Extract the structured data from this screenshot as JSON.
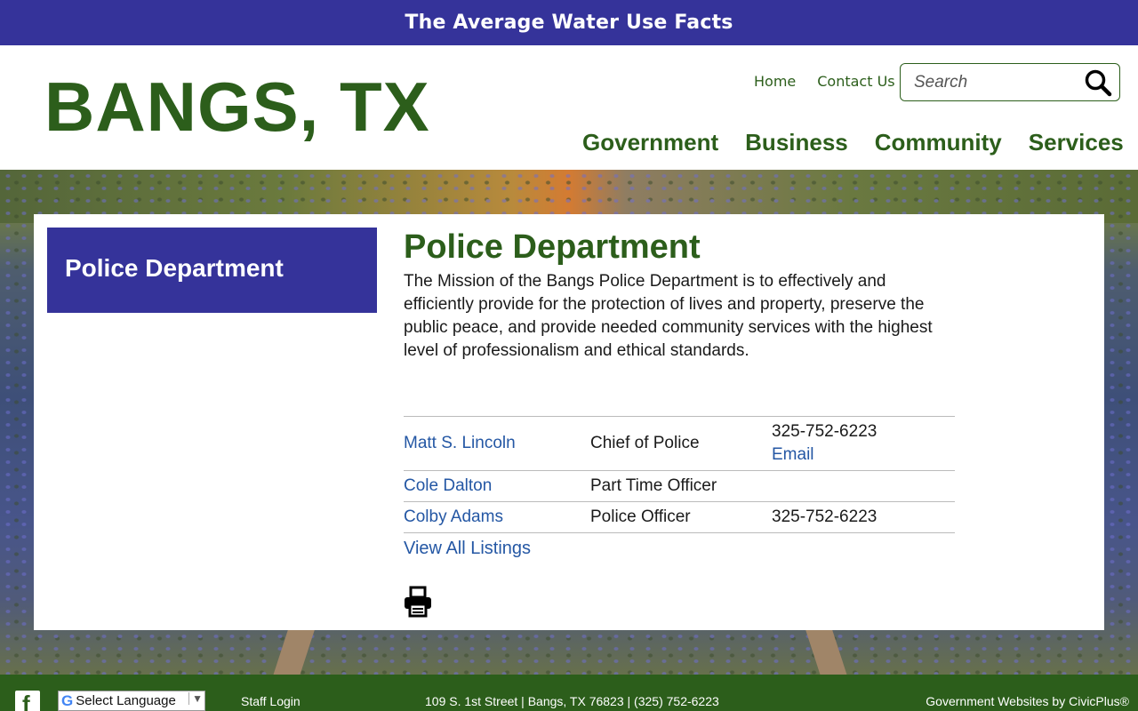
{
  "alert": {
    "text": "The Average Water Use Facts"
  },
  "header": {
    "site_title": "BANGS, TX",
    "util_links": [
      "Home",
      "Contact Us"
    ],
    "search_placeholder": "Search",
    "nav": [
      "Government",
      "Business",
      "Community",
      "Services"
    ]
  },
  "sidebar": {
    "title": "Police Department"
  },
  "main": {
    "title": "Police Department",
    "mission": "The Mission of the Bangs Police Department is to effectively and efficiently provide for the protection of lives and property, preserve the public peace, and provide needed community services with the highest level of professionalism and ethical standards.",
    "staff": [
      {
        "name": "Matt S. Lincoln",
        "title": "Chief of Police",
        "phone": "325-752-6223",
        "email": "Email"
      },
      {
        "name": "Cole Dalton",
        "title": "Part Time Officer",
        "phone": "",
        "email": ""
      },
      {
        "name": "Colby Adams",
        "title": "Police Officer",
        "phone": "325-752-6223",
        "email": ""
      }
    ],
    "view_all": "View All Listings",
    "print_icon": "printer-icon"
  },
  "footer": {
    "language_label": "Select Language",
    "staff_login": "Staff Login",
    "address": "109 S. 1st Street | Bangs, TX 76823 | (325) 752-6223",
    "credit": "Government Websites by CivicPlus®"
  },
  "colors": {
    "primary_blue": "#35339a",
    "brand_green": "#2c5e1b",
    "link_blue": "#2457a4"
  }
}
